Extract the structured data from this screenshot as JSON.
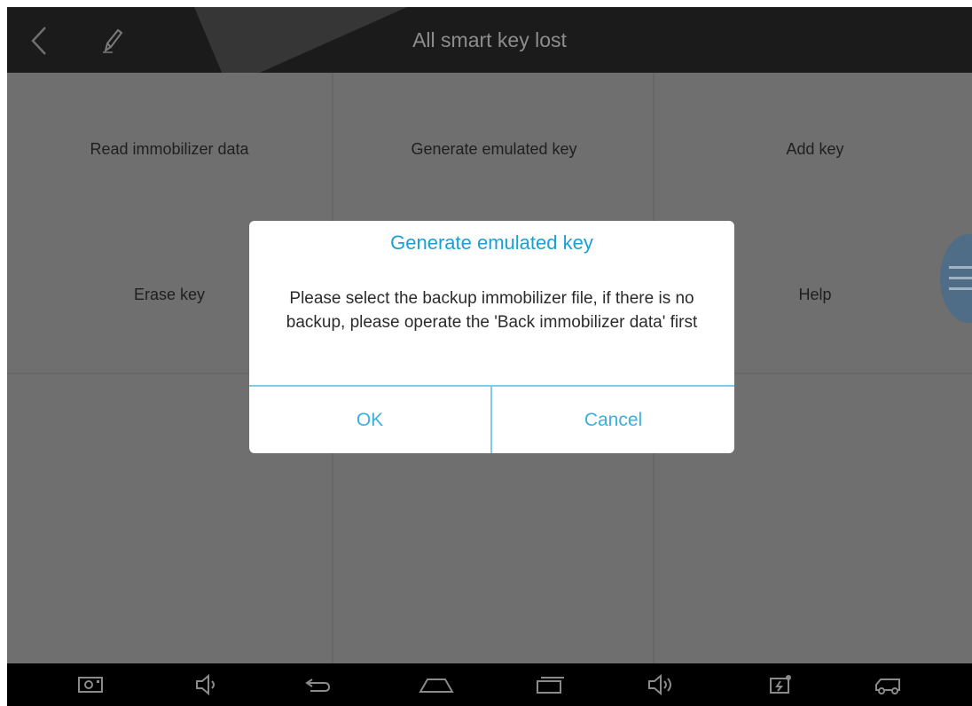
{
  "header": {
    "title": "All smart key lost",
    "back_icon": "chevron-left-icon",
    "edit_icon": "pencil-icon"
  },
  "menu": {
    "items": [
      {
        "label": "Read immobilizer data"
      },
      {
        "label": "Generate emulated key"
      },
      {
        "label": "Add key"
      },
      {
        "label": "Erase key"
      },
      {
        "label": "Help"
      }
    ]
  },
  "dialog": {
    "title": "Generate emulated key",
    "message": "Please select the backup immobilizer file, if there is no backup, please operate the 'Back immobilizer data' first",
    "ok_label": "OK",
    "cancel_label": "Cancel"
  },
  "navbar": {
    "icons": [
      "screenshot-icon",
      "volume-down-icon",
      "back-icon",
      "home-icon",
      "recent-apps-icon",
      "volume-up-icon",
      "battery-icon",
      "car-icon"
    ]
  },
  "colors": {
    "accent": "#1aa0d8",
    "topbar": "#1b1b1b",
    "overlay": "#6f6f6f"
  }
}
